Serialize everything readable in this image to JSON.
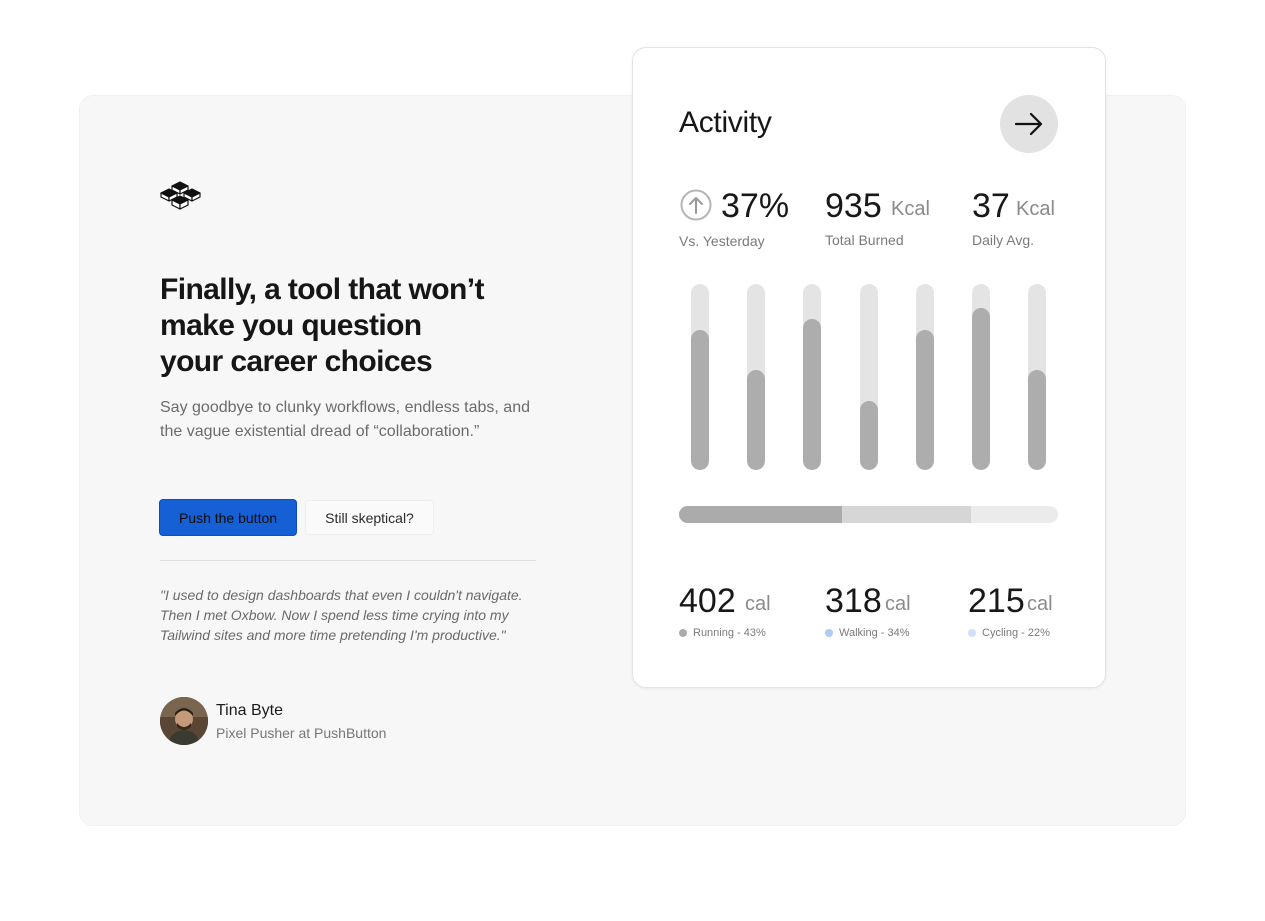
{
  "hero": {
    "headline_lines": [
      "Finally, a tool that won’t",
      "make you question",
      "your career choices"
    ],
    "subtext": "Say goodbye to clunky workflows, endless tabs, and the vague existential dread of “collaboration.”",
    "primary_button": "Push the button",
    "secondary_button": "Still skeptical?",
    "quote": "\"I used to design dashboards that even I couldn't navigate. Then I met Oxbow. Now I spend less time crying into my Tailwind sites and more time pretending I'm productive.\"",
    "author": {
      "name": "Tina Byte",
      "role": "Pixel Pusher at PushButton"
    },
    "colors": {
      "primary_button": "#1560d4",
      "panel_background": "#f7f7f7"
    },
    "icons": {
      "logo": "cubes-logo-icon",
      "avatar": "avatar-photo"
    }
  },
  "activity_card": {
    "title": "Activity",
    "arrow_icon": "arrow-right-icon",
    "stats": [
      {
        "value": "37%",
        "unit": "",
        "label": "Vs. Yesterday",
        "icon": "arrow-up-circle-icon"
      },
      {
        "value": "935",
        "unit": "Kcal",
        "label": "Total Burned"
      },
      {
        "value": "37",
        "unit": "Kcal",
        "label": "Daily Avg."
      }
    ],
    "breakdown": [
      {
        "value": "402",
        "unit": "cal",
        "label": "Running - 43%",
        "fraction": 0.43,
        "color": "#ababab"
      },
      {
        "value": "318",
        "unit": "cal",
        "label": "Walking - 34%",
        "fraction": 0.34,
        "color": "#aecbf0"
      },
      {
        "value": "215",
        "unit": "cal",
        "label": "Cycling - 22%",
        "fraction": 0.22,
        "color": "#cfe1f7"
      }
    ]
  },
  "chart_data": {
    "type": "bar",
    "categories": [],
    "values": [
      0.75,
      0.54,
      0.81,
      0.37,
      0.75,
      0.87,
      0.54
    ],
    "ylim": [
      0,
      1
    ],
    "title": "",
    "xlabel": "",
    "ylabel": "",
    "grid": false,
    "colors": {
      "fill": "#adadad",
      "track": "#e4e4e4"
    }
  }
}
